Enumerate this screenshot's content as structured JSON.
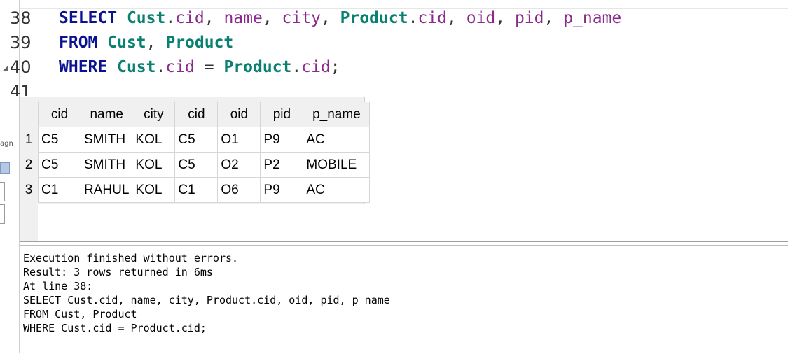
{
  "editor": {
    "line_numbers": [
      "38",
      "39",
      "40",
      "41"
    ],
    "lines": [
      [
        {
          "t": "SELECT",
          "c": "kw"
        },
        {
          "t": " ",
          "c": "punc"
        },
        {
          "t": "Cust",
          "c": "tbl"
        },
        {
          "t": ".",
          "c": "punc"
        },
        {
          "t": "cid",
          "c": "col"
        },
        {
          "t": ", ",
          "c": "punc"
        },
        {
          "t": "name",
          "c": "col"
        },
        {
          "t": ", ",
          "c": "punc"
        },
        {
          "t": "city",
          "c": "col"
        },
        {
          "t": ", ",
          "c": "punc"
        },
        {
          "t": "Product",
          "c": "tbl"
        },
        {
          "t": ".",
          "c": "punc"
        },
        {
          "t": "cid",
          "c": "col"
        },
        {
          "t": ", ",
          "c": "punc"
        },
        {
          "t": "oid",
          "c": "col"
        },
        {
          "t": ", ",
          "c": "punc"
        },
        {
          "t": "pid",
          "c": "col"
        },
        {
          "t": ", ",
          "c": "punc"
        },
        {
          "t": "p_name",
          "c": "col"
        }
      ],
      [
        {
          "t": "FROM",
          "c": "kw"
        },
        {
          "t": " ",
          "c": "punc"
        },
        {
          "t": "Cust",
          "c": "tbl"
        },
        {
          "t": ", ",
          "c": "punc"
        },
        {
          "t": "Product",
          "c": "tbl"
        }
      ],
      [
        {
          "t": "WHERE",
          "c": "kw"
        },
        {
          "t": " ",
          "c": "punc"
        },
        {
          "t": "Cust",
          "c": "tbl"
        },
        {
          "t": ".",
          "c": "punc"
        },
        {
          "t": "cid",
          "c": "col"
        },
        {
          "t": " = ",
          "c": "punc"
        },
        {
          "t": "Product",
          "c": "tbl"
        },
        {
          "t": ".",
          "c": "punc"
        },
        {
          "t": "cid",
          "c": "col"
        },
        {
          "t": ";",
          "c": "punc"
        }
      ]
    ]
  },
  "sidebar": {
    "stub_label": "agn"
  },
  "results": {
    "columns": [
      "cid",
      "name",
      "city",
      "cid",
      "oid",
      "pid",
      "p_name"
    ],
    "rows": [
      {
        "num": "1",
        "cells": [
          "C5",
          "SMITH",
          "KOL",
          "C5",
          "O1",
          "P9",
          "AC"
        ]
      },
      {
        "num": "2",
        "cells": [
          "C5",
          "SMITH",
          "KOL",
          "C5",
          "O2",
          "P2",
          "MOBILE"
        ]
      },
      {
        "num": "3",
        "cells": [
          "C1",
          "RAHUL",
          "KOL",
          "C1",
          "O6",
          "P9",
          "AC"
        ]
      }
    ]
  },
  "messages": {
    "lines": [
      "Execution finished without errors.",
      "Result: 3 rows returned in 6ms",
      "At line 38:",
      "SELECT Cust.cid, name, city, Product.cid, oid, pid, p_name",
      "FROM Cust, Product",
      "WHERE Cust.cid = Product.cid;"
    ]
  },
  "colors": {
    "keyword": "#0b128f",
    "table": "#0a8070",
    "column": "#8a2a8a"
  }
}
